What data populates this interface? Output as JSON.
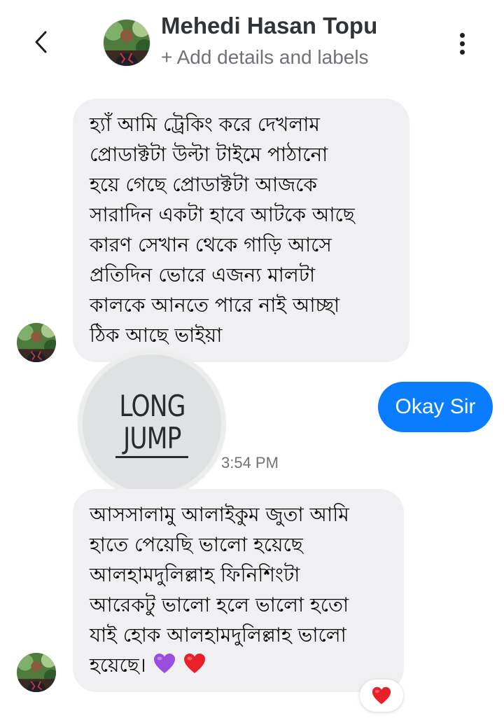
{
  "header": {
    "back_icon": "chevron-left-icon",
    "contact_name": "Mehedi Hasan Topu",
    "add_details_label": "+ Add details and labels",
    "menu_icon": "more-vertical-icon"
  },
  "messages": [
    {
      "direction": "incoming",
      "lines": [
        "হ্যাঁ আমি ট্রেকিং করে দেখলাম",
        "প্রোডাক্টটা উল্টা টাইমে পাঠানো",
        "হয়ে গেছে প্রোডাক্টটা আজকে",
        "সারাদিন একটা হাবে আটকে আছে",
        "কারণ সেখান থেকে গাড়ি আসে",
        "প্রতিদিন ভোরে এজন্য মালটা",
        "কালকে আনতে পারে নাই আচ্ছা",
        "ঠিক আছে ভাইয়া"
      ]
    },
    {
      "direction": "outgoing",
      "text": "Okay Sir"
    },
    {
      "direction": "incoming",
      "type": "sticker",
      "sticker_lines": [
        "LONG",
        "JUMP"
      ],
      "time": "3:54 PM"
    },
    {
      "direction": "incoming",
      "lines": [
        "আসসালামু আলাইকুম জুতা আমি",
        "হাতে পেয়েছি ভালো হয়েছে",
        "আলহামদুলিল্লাহ ফিনিশিংটা",
        "আরেকটু ভালো হলে ভালো হতো",
        "যাই হোক আলহামদুলিল্লাহ ভালো",
        "হয়েছে।"
      ],
      "trailing_emojis": [
        "purple-heart-icon",
        "red-heart-icon"
      ],
      "reaction": "red-heart-icon"
    }
  ],
  "colors": {
    "outgoing_bubble": "#0a7cff",
    "incoming_bubble": "#f0f0f3",
    "reaction_heart": "#e8202a",
    "purple_heart": "#9b4de0"
  }
}
